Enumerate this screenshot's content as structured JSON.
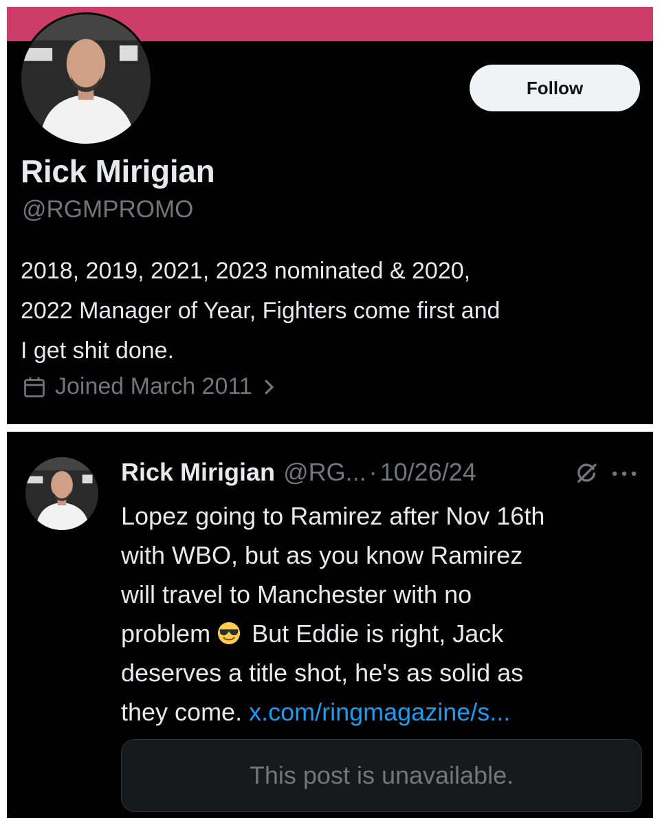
{
  "profile": {
    "banner_color": "#cc3d6b",
    "follow_label": "Follow",
    "display_name": "Rick Mirigian",
    "handle": "@RGMPROMO",
    "bio_lines": [
      "2018, 2019, 2021, 2023 nominated & 2020,",
      "2022 Manager of Year, Fighters come first and",
      "I get shit done."
    ],
    "joined": "Joined March 2011",
    "icons": {
      "joined": "calendar-icon",
      "joined_more": "chevron-right-icon"
    }
  },
  "post": {
    "author_name": "Rick Mirigian",
    "author_handle": "@RG...",
    "separator": "·",
    "date": "10/26/24",
    "icons": {
      "grok": "grok-icon",
      "more": "more-options-icon",
      "emoji": "smiling-face-with-sunglasses-emoji"
    },
    "text_lines": [
      "Lopez going to Ramirez after Nov 16th",
      "with WBO, but as you know Ramirez",
      "will travel to Manchester with no",
      "problem",
      "But Eddie is right, Jack",
      "deserves a title shot, he's as solid as",
      "they come."
    ],
    "link": "x.com/ringmagazine/s...",
    "quoted_unavailable": "This post is unavailable."
  },
  "colors": {
    "background": "#000000",
    "text": "#e7e9ea",
    "muted": "#71767b",
    "link": "#1d9bf0"
  }
}
